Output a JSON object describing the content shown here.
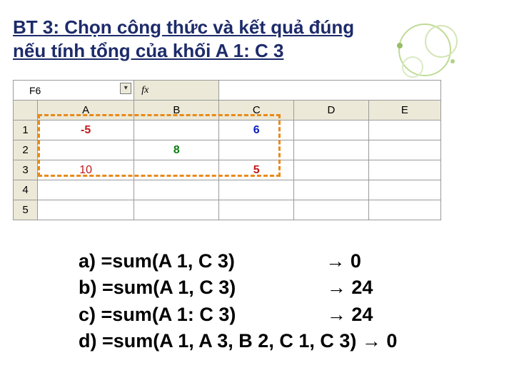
{
  "title": "BT 3: Chọn công thức và kết quả đúng nếu tính tổng của khối A 1: C 3",
  "excel": {
    "namebox": "F6",
    "fx_label": "fx",
    "columns": [
      "A",
      "B",
      "C",
      "D",
      "E"
    ],
    "row_labels": [
      "1",
      "2",
      "3",
      "4",
      "5"
    ],
    "cells": {
      "A1": "-5",
      "C1": "6",
      "B2": "8",
      "A3": "10",
      "C3": "5"
    }
  },
  "answers": [
    {
      "key": "a)",
      "formula": "=sum(A 1, C 3)",
      "arrow": "→",
      "result": "0"
    },
    {
      "key": "b)",
      "formula": "=sum(A 1, C 3)",
      "arrow": "→",
      "result": "24"
    },
    {
      "key": "c)",
      "formula": "=sum(A 1: C 3)",
      "arrow": "→",
      "result": "24"
    },
    {
      "key": "d)",
      "formula": "=sum(A 1, A 3, B 2, C 1, C 3)",
      "arrow": "→",
      "result": "0"
    }
  ]
}
